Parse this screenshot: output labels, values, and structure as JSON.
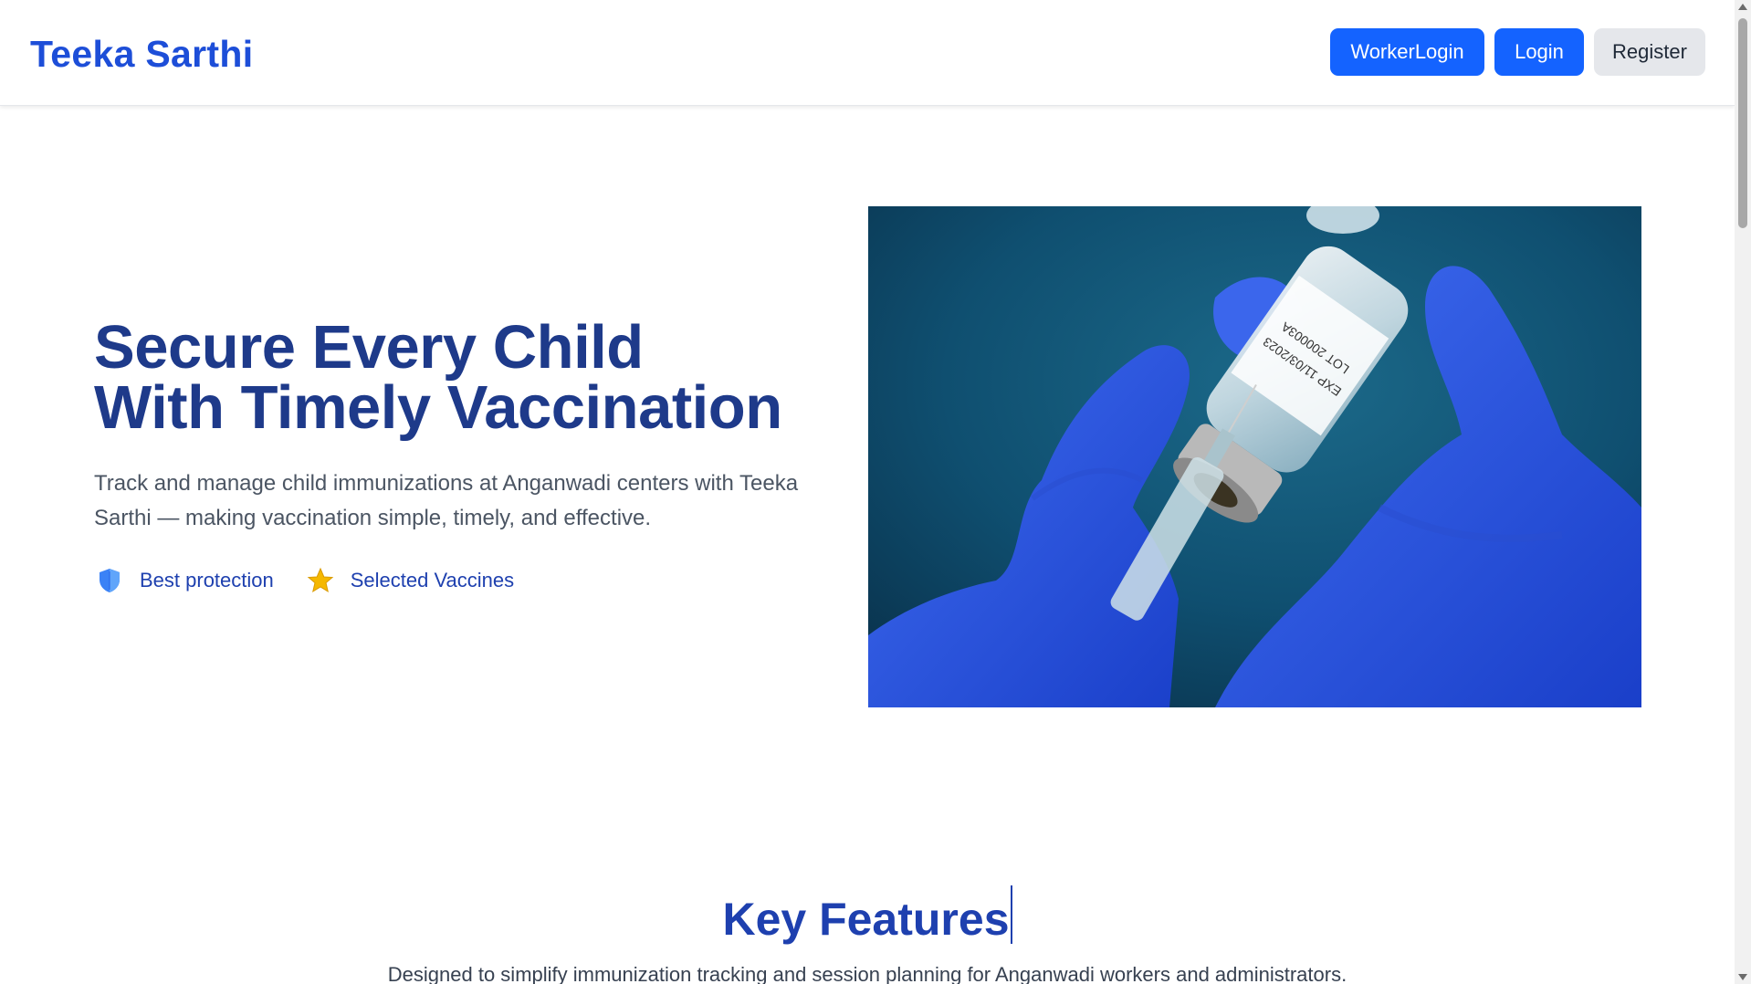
{
  "header": {
    "brand": "Teeka Sarthi",
    "buttons": {
      "worker_login": "WorkerLogin",
      "login": "Login",
      "register": "Register"
    }
  },
  "hero": {
    "title_line1": "Secure Every Child",
    "title_line2": "With Timely Vaccination",
    "description": "Track and manage child immunizations at Anganwadi centers with Teeka Sarthi — making vaccination simple, timely, and effective.",
    "badges": [
      {
        "icon": "shield-icon",
        "label": "Best protection"
      },
      {
        "icon": "star-icon",
        "label": "Selected Vaccines"
      }
    ],
    "image": {
      "vial_text_line1": "LOT 200003A",
      "vial_text_line2": "EXP 11/03/2023"
    }
  },
  "features": {
    "title": "Key Features",
    "subtitle": "Designed to simplify immunization tracking and session planning for Anganwadi workers and administrators."
  },
  "colors": {
    "brand": "#1d4ed8",
    "primary_button": "#1463ff",
    "secondary_button": "#e5e7eb",
    "heading": "#1e3a8a"
  }
}
